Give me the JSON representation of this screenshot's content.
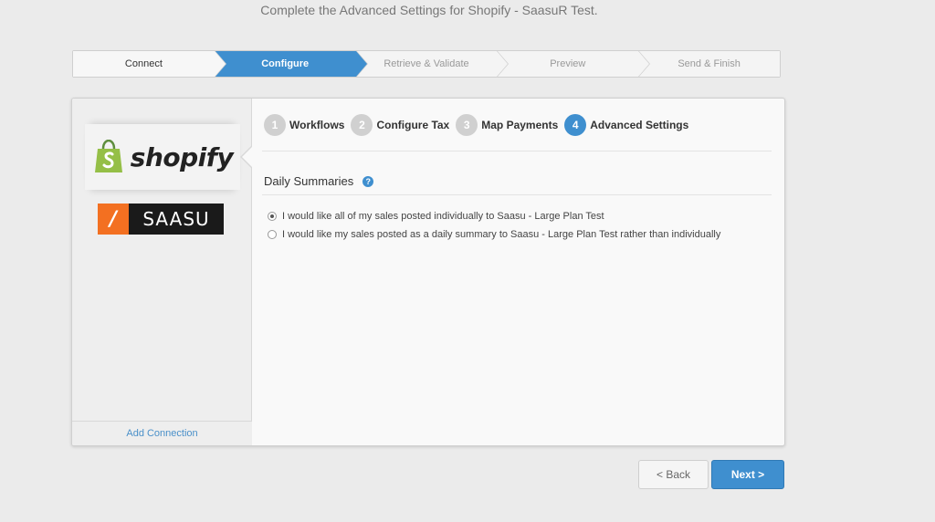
{
  "header": {
    "title": "Complete the Advanced Settings for Shopify - SaasuR Test."
  },
  "wizard": {
    "steps": [
      {
        "label": "Connect",
        "state": "done"
      },
      {
        "label": "Configure",
        "state": "active"
      },
      {
        "label": "Retrieve & Validate",
        "state": "pending"
      },
      {
        "label": "Preview",
        "state": "pending"
      },
      {
        "label": "Send & Finish",
        "state": "pending"
      }
    ]
  },
  "sidebar": {
    "logos": [
      {
        "name": "shopify",
        "text": "shopify",
        "color": "#95bf47"
      },
      {
        "name": "saasu",
        "mark": "/",
        "text": "SAASU",
        "color": "#f37021"
      }
    ],
    "add_connection": "Add Connection"
  },
  "substeps": [
    {
      "num": "1",
      "label": "Workflows",
      "active": false
    },
    {
      "num": "2",
      "label": "Configure Tax",
      "active": false
    },
    {
      "num": "3",
      "label": "Map Payments",
      "active": false
    },
    {
      "num": "4",
      "label": "Advanced Settings",
      "active": true
    }
  ],
  "section": {
    "title": "Daily Summaries",
    "help_icon": "?",
    "options": [
      {
        "label": "I would like all of my sales posted individually to Saasu - Large Plan Test",
        "checked": true
      },
      {
        "label": "I would like my sales posted as a daily summary to Saasu - Large Plan Test rather than individually",
        "checked": false
      }
    ]
  },
  "buttons": {
    "back": "< Back",
    "next": "Next >"
  },
  "colors": {
    "accent": "#3f8fcf",
    "link": "#4a90c9"
  }
}
